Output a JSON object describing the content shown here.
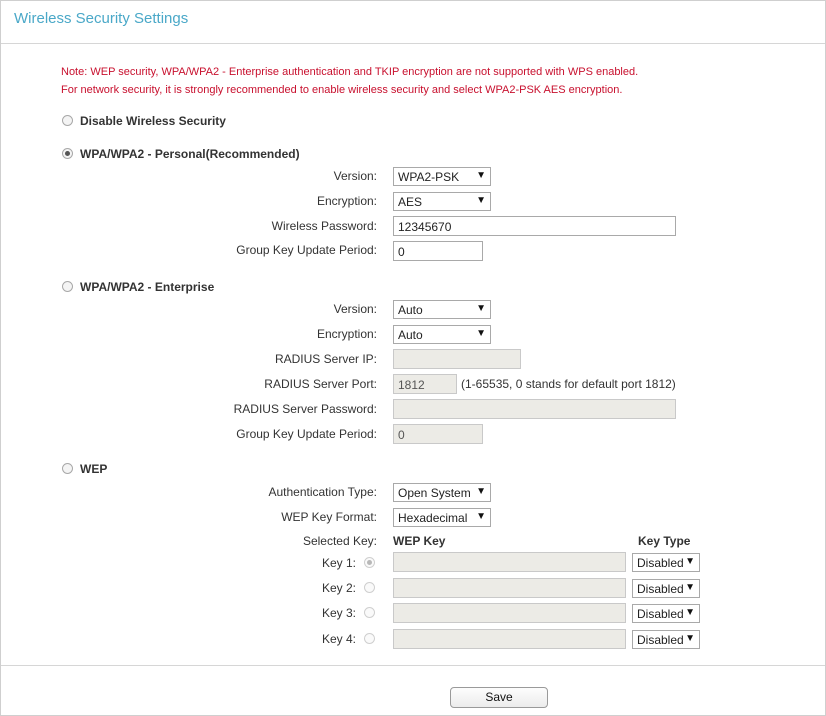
{
  "page": {
    "title": "Wireless Security Settings"
  },
  "notes": [
    "Note: WEP security, WPA/WPA2 - Enterprise authentication and TKIP encryption are not supported with WPS enabled.",
    "For network security, it is strongly recommended to enable wireless security and select WPA2-PSK AES encryption."
  ],
  "disable": {
    "label": "Disable Wireless Security",
    "selected": false
  },
  "personal": {
    "label": "WPA/WPA2 - Personal(Recommended)",
    "selected": true,
    "version": {
      "label": "Version:",
      "value": "WPA2-PSK"
    },
    "encryption": {
      "label": "Encryption:",
      "value": "AES"
    },
    "password": {
      "label": "Wireless Password:",
      "value": "12345670"
    },
    "group_key": {
      "label": "Group Key Update Period:",
      "value": "0"
    }
  },
  "enterprise": {
    "label": "WPA/WPA2 - Enterprise",
    "selected": false,
    "version": {
      "label": "Version:",
      "value": "Auto"
    },
    "encryption": {
      "label": "Encryption:",
      "value": "Auto"
    },
    "radius_ip": {
      "label": "RADIUS Server IP:",
      "value": ""
    },
    "radius_port": {
      "label": "RADIUS Server Port:",
      "value": "1812",
      "hint": "(1-65535, 0 stands for default port 1812)"
    },
    "radius_password": {
      "label": "RADIUS Server Password:",
      "value": ""
    },
    "group_key": {
      "label": "Group Key Update Period:",
      "value": "0"
    }
  },
  "wep": {
    "label": "WEP",
    "selected": false,
    "auth_type": {
      "label": "Authentication Type:",
      "value": "Open System"
    },
    "key_format": {
      "label": "WEP Key Format:",
      "value": "Hexadecimal"
    },
    "selected_key_label": "Selected Key:",
    "col_wep_key": "WEP Key",
    "col_key_type": "Key Type",
    "keys": [
      {
        "label": "Key 1:",
        "value": "",
        "type": "Disabled",
        "selected": true
      },
      {
        "label": "Key 2:",
        "value": "",
        "type": "Disabled",
        "selected": false
      },
      {
        "label": "Key 3:",
        "value": "",
        "type": "Disabled",
        "selected": false
      },
      {
        "label": "Key 4:",
        "value": "",
        "type": "Disabled",
        "selected": false
      }
    ]
  },
  "save_label": "Save",
  "icons": {
    "dropdown": "caret-down-icon",
    "radio": "radio-icon"
  }
}
